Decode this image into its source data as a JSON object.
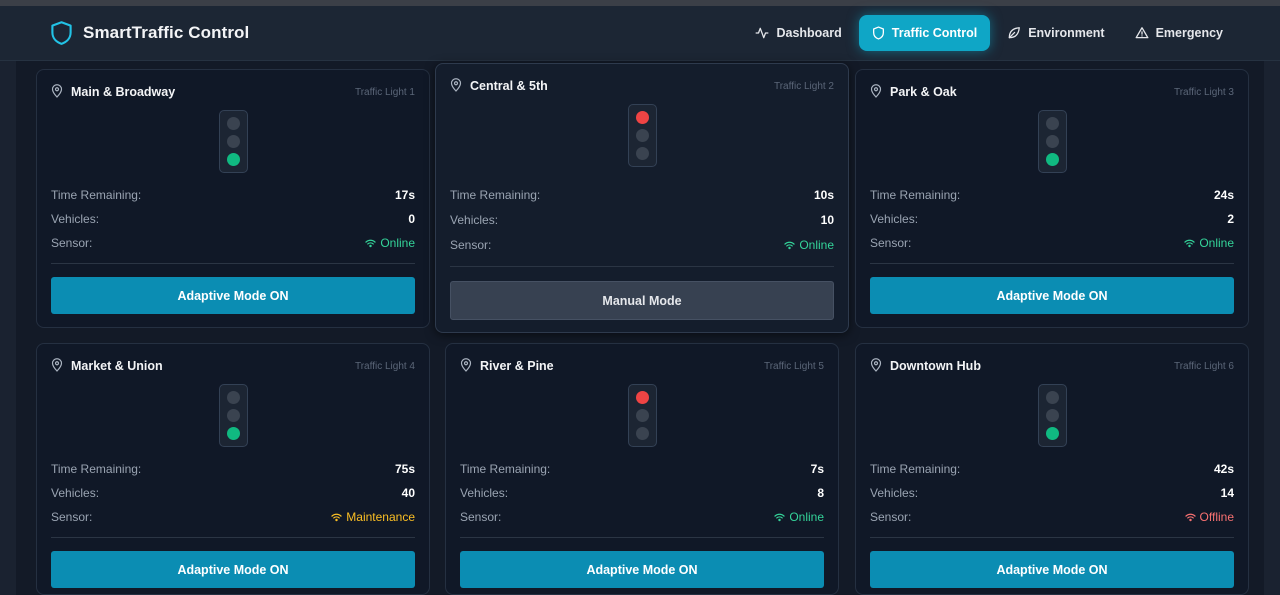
{
  "app": {
    "title": "SmartTraffic Control"
  },
  "nav": [
    {
      "label": "Dashboard",
      "icon": "activity-icon",
      "active": false
    },
    {
      "label": "Traffic Control",
      "icon": "shield-icon",
      "active": true
    },
    {
      "label": "Environment",
      "icon": "leaf-icon",
      "active": false
    },
    {
      "label": "Emergency",
      "icon": "alert-triangle-icon",
      "active": false
    }
  ],
  "labels": {
    "time": "Time Remaining:",
    "vehicles": "Vehicles:",
    "sensor": "Sensor:"
  },
  "colors": {
    "accent": "#0fa6c6",
    "adaptive_button": "#0b8db3",
    "manual_button": "#374151",
    "red_light": "#ef4444",
    "green_light": "#10b981",
    "online": "#34d399",
    "maintenance": "#fbbf24",
    "offline": "#f87171"
  },
  "lights": [
    {
      "name": "Main & Broadway",
      "id_label": "Traffic Light 1",
      "signal": "green",
      "time": "17s",
      "vehicles": "0",
      "sensor": "Online",
      "sensor_status": "online",
      "mode_label": "Adaptive Mode ON",
      "adaptive": true
    },
    {
      "name": "Central & 5th",
      "id_label": "Traffic Light 2",
      "signal": "red",
      "time": "10s",
      "vehicles": "10",
      "sensor": "Online",
      "sensor_status": "online",
      "mode_label": "Manual Mode",
      "adaptive": false
    },
    {
      "name": "Park & Oak",
      "id_label": "Traffic Light 3",
      "signal": "green",
      "time": "24s",
      "vehicles": "2",
      "sensor": "Online",
      "sensor_status": "online",
      "mode_label": "Adaptive Mode ON",
      "adaptive": true
    },
    {
      "name": "Market & Union",
      "id_label": "Traffic Light 4",
      "signal": "green",
      "time": "75s",
      "vehicles": "40",
      "sensor": "Maintenance",
      "sensor_status": "maintenance",
      "mode_label": "Adaptive Mode ON",
      "adaptive": true
    },
    {
      "name": "River & Pine",
      "id_label": "Traffic Light 5",
      "signal": "red",
      "time": "7s",
      "vehicles": "8",
      "sensor": "Online",
      "sensor_status": "online",
      "mode_label": "Adaptive Mode ON",
      "adaptive": true
    },
    {
      "name": "Downtown Hub",
      "id_label": "Traffic Light 6",
      "signal": "green",
      "time": "42s",
      "vehicles": "14",
      "sensor": "Offline",
      "sensor_status": "offline",
      "mode_label": "Adaptive Mode ON",
      "adaptive": true
    }
  ]
}
